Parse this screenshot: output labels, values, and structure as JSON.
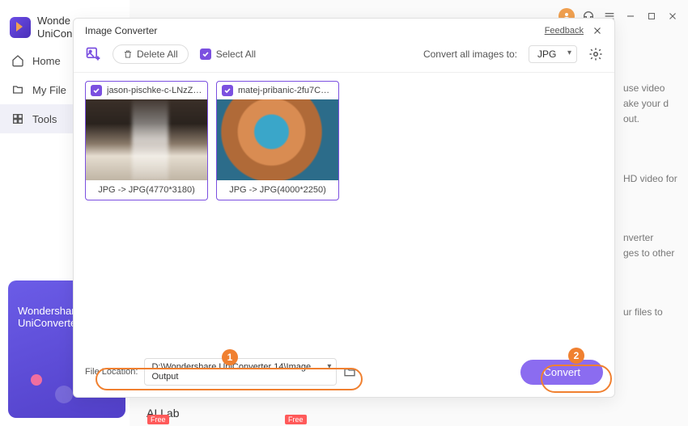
{
  "app": {
    "name_line1": "Wonde",
    "name_line2": "UniCon"
  },
  "nav": {
    "home": "Home",
    "files": "My File",
    "tools": "Tools"
  },
  "promo": {
    "line1": "Wondershare",
    "line2": "UniConverte"
  },
  "modal": {
    "title": "Image Converter",
    "feedback": "Feedback",
    "delete_all": "Delete All",
    "select_all": "Select All",
    "convert_to_label": "Convert all images to:",
    "format": "JPG",
    "files": [
      {
        "name": "jason-pischke-c-LNzZxJtZ...",
        "footer": "JPG -> JPG(4770*3180)"
      },
      {
        "name": "matej-pribanic-2fu7CsklT...",
        "footer": "JPG -> JPG(4000*2250)"
      }
    ],
    "file_location_label": "File Location:",
    "file_location_path": "D:\\Wondershare UniConverter 14\\Image Output",
    "convert_btn": "Convert"
  },
  "hints": {
    "h1": "use video ake your d out.",
    "h2": "HD video for",
    "h3": "nverter\n ges to other",
    "h4": "ur files to"
  },
  "callouts": {
    "one": "1",
    "two": "2"
  },
  "bottom": {
    "ai_lab": "AI Lab",
    "free": "Free"
  }
}
